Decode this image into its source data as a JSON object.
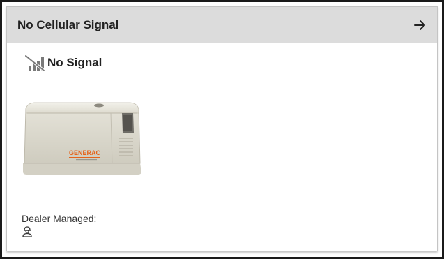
{
  "header": {
    "title": "No Cellular Signal",
    "action_icon": "arrow-right-icon"
  },
  "status": {
    "icon": "no-signal-icon",
    "label": "No Signal"
  },
  "device": {
    "image": "generator-image",
    "brand": "GENERAC"
  },
  "dealer": {
    "label": "Dealer Managed:",
    "icon": "dealer-person-icon"
  },
  "colors": {
    "header_bg": "#dcdcdc",
    "generac_orange": "#e5631a",
    "icon_gray": "#7a7a7a"
  }
}
